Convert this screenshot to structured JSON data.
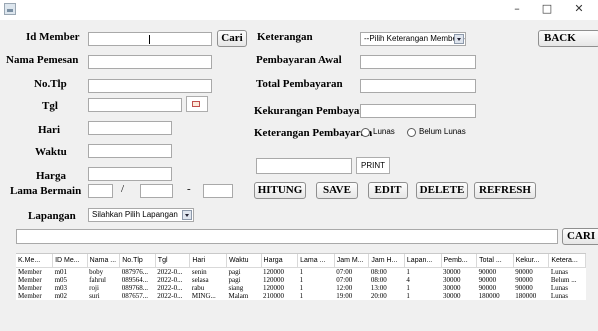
{
  "window": {
    "minimize_glyph": "–",
    "maximize_glyph": "□",
    "close_glyph": "✕"
  },
  "form": {
    "id_member_label": "Id Member",
    "nama_pemesan_label": "Nama Pemesan",
    "no_tlp_label": "No.Tlp",
    "tgl_label": "Tgl",
    "hari_label": "Hari",
    "waktu_label": "Waktu",
    "harga_label": "Harga",
    "lama_bermain_label": "Lama Bermain",
    "lama_sep1": "/",
    "lama_sep2": "-",
    "lapangan_label": "Lapangan",
    "lapangan_selected": "Silahkan Pilih Lapangan",
    "keterangan_label": "Keterangan",
    "keterangan_selected": "--Pilih Keterangan Member--",
    "pembayaran_awal_label": "Pembayaran Awal",
    "total_pembayaran_label": "Total Pembayaran",
    "kekurangan_pembayaran_label": "Kekurangan Pembayaran",
    "keterangan_pembayaran_label": "Keterangan Pembayaran",
    "radio_lunas": "Lunas",
    "radio_belum_lunas": "Belum Lunas"
  },
  "buttons": {
    "cari": "Cari",
    "back": "BACK",
    "print": "PRINT",
    "hitung": "HITUNG",
    "save": "SAVE",
    "edit": "EDIT",
    "delete": "DELETE",
    "refresh": "REFRESH",
    "search2": "CARI"
  },
  "table": {
    "columns": [
      "K.Me...",
      "ID Me...",
      "Nama ...",
      "No.Tlp",
      "Tgl",
      "Hari",
      "Waktu",
      "Harga",
      "Lama ...",
      "Jam M...",
      "Jam H...",
      "Lapan...",
      "Pemb...",
      "Total ...",
      "Kekur...",
      "Ketera..."
    ],
    "rows": [
      [
        "Member",
        "m01",
        "boby",
        "087976...",
        "2022-0...",
        "senin",
        "pagi",
        "120000",
        "1",
        "07:00",
        "08:00",
        "1",
        "30000",
        "90000",
        "90000",
        "Lunas"
      ],
      [
        "Member",
        "m05",
        "fahrul",
        "089564...",
        "2022-0...",
        "selasa",
        "pagi",
        "120000",
        "1",
        "07:00",
        "08:00",
        "4",
        "30000",
        "90000",
        "90000",
        "Belum ..."
      ],
      [
        "Member",
        "m03",
        "roji",
        "089768...",
        "2022-0...",
        "rabu",
        "siang",
        "120000",
        "1",
        "12:00",
        "13:00",
        "1",
        "30000",
        "90000",
        "90000",
        "Lunas"
      ],
      [
        "Member",
        "m02",
        "suri",
        "087657...",
        "2022-0...",
        "MING...",
        "Malam",
        "210000",
        "1",
        "19:00",
        "20:00",
        "1",
        "30000",
        "180000",
        "180000",
        "Lunas"
      ]
    ]
  }
}
